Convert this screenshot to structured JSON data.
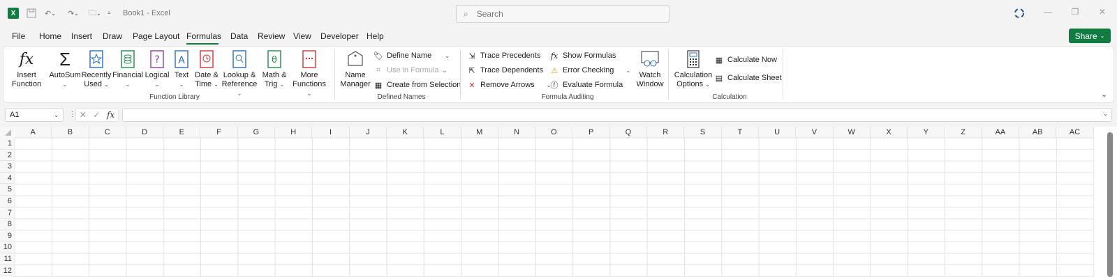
{
  "titlebar": {
    "app_icon": "X",
    "doc_title": "Book1  -  Excel",
    "search_placeholder": "Search"
  },
  "menu": [
    "File",
    "Home",
    "Insert",
    "Draw",
    "Page Layout",
    "Formulas",
    "Data",
    "Review",
    "View",
    "Developer",
    "Help"
  ],
  "active_tab": "Formulas",
  "share_label": "Share",
  "ribbon": {
    "function_library": {
      "label": "Function Library",
      "insert_function": [
        "Insert",
        "Function"
      ],
      "autosum": "AutoSum",
      "recently_used": [
        "Recently",
        "Used"
      ],
      "financial": "Financial",
      "logical": "Logical",
      "text": "Text",
      "date_time": [
        "Date &",
        "Time"
      ],
      "lookup": [
        "Lookup &",
        "Reference"
      ],
      "math": [
        "Math &",
        "Trig"
      ],
      "more": [
        "More",
        "Functions"
      ]
    },
    "defined_names": {
      "label": "Defined Names",
      "name_manager": [
        "Name",
        "Manager"
      ],
      "define_name": "Define Name",
      "use_in_formula": "Use in Formula",
      "create_from_selection": "Create from Selection"
    },
    "formula_auditing": {
      "label": "Formula Auditing",
      "trace_precedents": "Trace Precedents",
      "trace_dependents": "Trace Dependents",
      "remove_arrows": "Remove Arrows",
      "show_formulas": "Show Formulas",
      "error_checking": "Error Checking",
      "evaluate_formula": "Evaluate Formula",
      "watch_window": [
        "Watch",
        "Window"
      ]
    },
    "calculation": {
      "label": "Calculation",
      "calc_options": [
        "Calculation",
        "Options"
      ],
      "calc_now": "Calculate Now",
      "calc_sheet": "Calculate Sheet"
    }
  },
  "formula_bar": {
    "name_box": "A1",
    "fx": "fx",
    "value": ""
  },
  "columns": [
    "A",
    "B",
    "C",
    "D",
    "E",
    "F",
    "G",
    "H",
    "I",
    "J",
    "K",
    "L",
    "M",
    "N",
    "O",
    "P",
    "Q",
    "R",
    "S",
    "T",
    "U",
    "V",
    "W",
    "X",
    "Y",
    "Z",
    "AA",
    "AB",
    "AC"
  ],
  "rows": [
    "1",
    "2",
    "3",
    "4",
    "5",
    "6",
    "7",
    "8",
    "9",
    "10",
    "11",
    "12"
  ],
  "colors": {
    "accent": "#107c41"
  }
}
